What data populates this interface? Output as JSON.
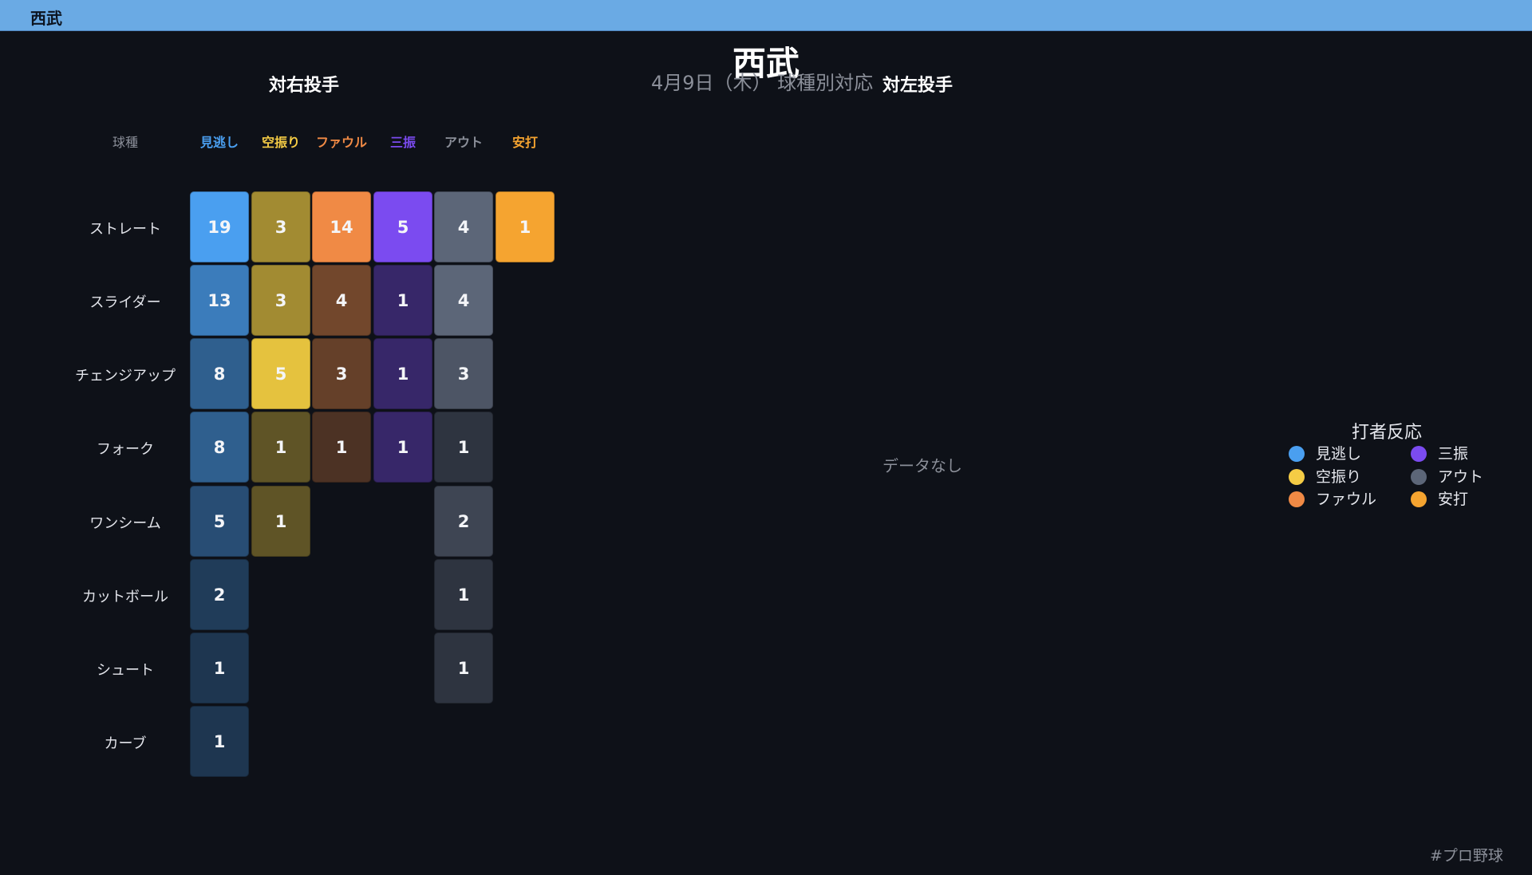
{
  "topbar": {
    "title": "西武"
  },
  "title": "西武",
  "subtitle": "4月9日（木） 球種別対応",
  "panels": {
    "right": {
      "title": "対右投手"
    },
    "left": {
      "title": "対左投手",
      "empty_text": "データなし"
    }
  },
  "legend": {
    "title": "打者反応",
    "items": [
      {
        "label": "見逃し",
        "color": "#4a9ff0"
      },
      {
        "label": "三振",
        "color": "#7b4bf0"
      },
      {
        "label": "空振り",
        "color": "#f5cc45"
      },
      {
        "label": "アウト",
        "color": "#5c6678"
      },
      {
        "label": "ファウル",
        "color": "#f08a45"
      },
      {
        "label": "安打",
        "color": "#f5a430"
      }
    ]
  },
  "footer": {
    "hashtag": "#プロ野球"
  },
  "chart_data": {
    "type": "heatmap",
    "title": "対右投手",
    "corner_label": "球種",
    "columns": [
      {
        "label": "見逃し",
        "color": "#4a9ff0"
      },
      {
        "label": "空振り",
        "color": "#f5cc45"
      },
      {
        "label": "ファウル",
        "color": "#f08a45"
      },
      {
        "label": "三振",
        "color": "#7b4bf0"
      },
      {
        "label": "アウト",
        "color": "#8b8f99"
      },
      {
        "label": "安打",
        "color": "#f5a430"
      }
    ],
    "cell_colors": [
      "#4a9ff0",
      "#e5c23e",
      "#f08a45",
      "#7b4bf0",
      "#5c6678",
      "#f5a430"
    ],
    "rows": [
      {
        "label": "ストレート",
        "values": [
          19,
          3,
          14,
          5,
          4,
          1
        ]
      },
      {
        "label": "スライダー",
        "values": [
          13,
          3,
          4,
          1,
          4,
          null
        ]
      },
      {
        "label": "チェンジアップ",
        "values": [
          8,
          5,
          3,
          1,
          3,
          null
        ]
      },
      {
        "label": "フォーク",
        "values": [
          8,
          1,
          1,
          1,
          1,
          null
        ]
      },
      {
        "label": "ワンシーム",
        "values": [
          5,
          1,
          null,
          null,
          2,
          null
        ]
      },
      {
        "label": "カットボール",
        "values": [
          2,
          null,
          null,
          null,
          1,
          null
        ]
      },
      {
        "label": "シュート",
        "values": [
          1,
          null,
          null,
          null,
          1,
          null
        ]
      },
      {
        "label": "カーブ",
        "values": [
          1,
          null,
          null,
          null,
          null,
          null
        ]
      }
    ]
  }
}
